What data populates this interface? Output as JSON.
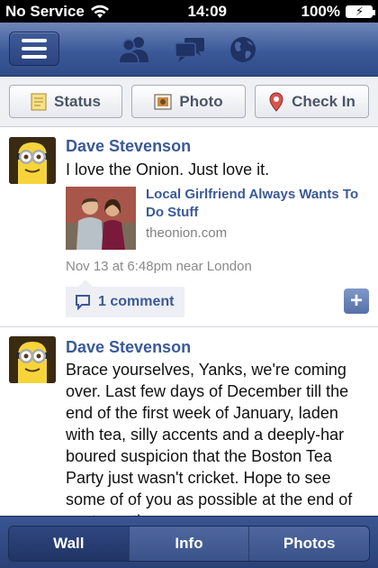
{
  "status_bar": {
    "carrier": "No Service",
    "time": "14:09",
    "battery": "100%",
    "icons": [
      "wifi-icon",
      "battery-icon"
    ]
  },
  "nav_bar": {
    "icons": [
      "menu-icon",
      "friends-icon",
      "messages-icon",
      "notifications-globe-icon"
    ]
  },
  "actions": {
    "status_label": "Status",
    "photo_label": "Photo",
    "checkin_label": "Check In"
  },
  "posts": [
    {
      "author": "Dave Stevenson",
      "text": "I love the Onion. Just love it.",
      "link": {
        "title": "Local Girlfriend Always Wants To Do Stuff",
        "domain": "theonion.com"
      },
      "meta": "Nov 13 at 6:48pm near London",
      "comment_label": "1 comment"
    },
    {
      "author": "Dave Stevenson",
      "text": "Brace yourselves, Yanks, we're coming over. Last few days of December till the end of the first week of January, laden with tea, silly accents and a deeply-har boured suspicion that the Boston Tea Party just wasn't cricket. Hope to see some of of you as possible at the end of next month."
    }
  ],
  "tabs": {
    "wall": "Wall",
    "info": "Info",
    "photos": "Photos"
  },
  "colors": {
    "brand_blue": "#3b5998",
    "link_blue": "#3b5998",
    "meta_gray": "#8a8a8a"
  }
}
